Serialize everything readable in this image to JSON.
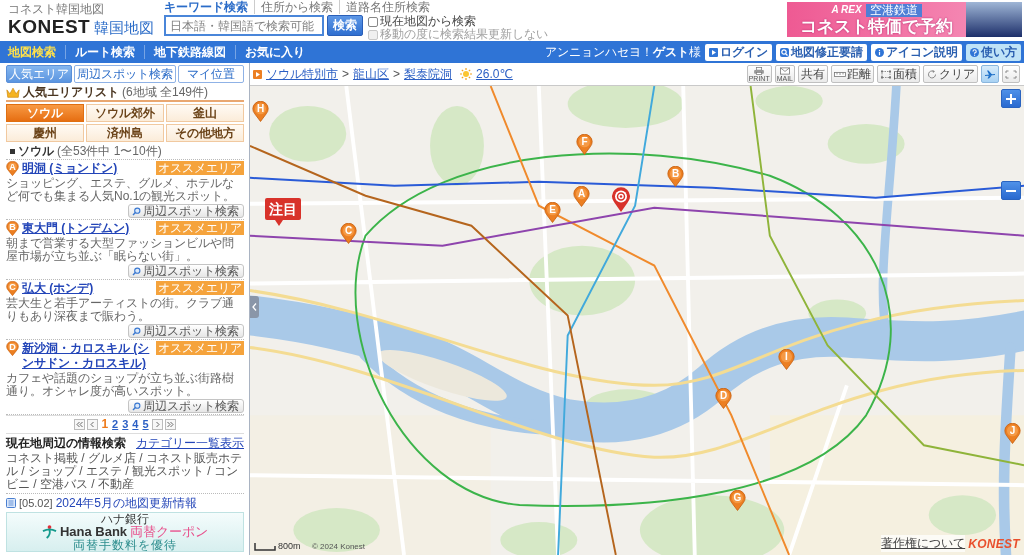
{
  "header": {
    "logo_caption": "コネスト韓国地図",
    "logo": "KONEST",
    "logo_suffix": "韓国地図",
    "search_tabs": [
      {
        "label": "キーワード検索",
        "selected": true
      },
      {
        "label": "住所から検索",
        "selected": false
      },
      {
        "label": "道路名住所検索",
        "selected": false
      }
    ],
    "search": {
      "placeholder": "日本語・韓国語で検索可能",
      "button": "検索"
    },
    "options": [
      {
        "label": "現在地図から検索",
        "checked": false,
        "disabled": false
      },
      {
        "label": "移動の度に検索結果更新しない",
        "checked": false,
        "disabled": true
      }
    ],
    "banner": {
      "brand": "A REX",
      "tag": "空港鉄道",
      "headline": "コネスト特価で予約"
    }
  },
  "nav": {
    "items": [
      {
        "label": "地図検索",
        "selected": true
      },
      {
        "label": "ルート検索",
        "selected": false
      },
      {
        "label": "地下鉄路線図",
        "selected": false
      },
      {
        "label": "お気に入り",
        "selected": false
      }
    ],
    "greeting": "アンニョンハセヨ！**ゲスト**様",
    "buttons": [
      {
        "kind": "login",
        "label": "ログイン"
      },
      {
        "kind": "report",
        "label": "地図修正要請"
      },
      {
        "kind": "info",
        "label": "アイコン説明"
      },
      {
        "kind": "help",
        "label": "使い方"
      }
    ]
  },
  "sidebar": {
    "tabs": [
      {
        "label": "人気エリア",
        "selected": true
      },
      {
        "label": "周辺スポット検索",
        "selected": false
      },
      {
        "label": "マイ位置",
        "selected": false
      }
    ],
    "list_title": "**人気エリア**リスト",
    "list_count": "(6地域 全149件)",
    "regions": [
      {
        "label": "ソウル",
        "selected": true
      },
      {
        "label": "ソウル郊外",
        "selected": false
      },
      {
        "label": "釜山",
        "selected": false
      },
      {
        "label": "慶州",
        "selected": false
      },
      {
        "label": "済州島",
        "selected": false
      },
      {
        "label": "その他地方",
        "selected": false
      }
    ],
    "section": {
      "title": "ソウル",
      "count": "(全53件中 1〜10件)"
    },
    "areas": [
      {
        "marker": "A",
        "name": "明洞 (ミョンドン)",
        "badge": "オススメエリア",
        "description": "ショッピング、エステ、グルメ、ホテルなど何でも集まる人気No.1の観光スポット。",
        "button": "周辺スポット検索"
      },
      {
        "marker": "B",
        "name": "東大門 (トンデムン)",
        "badge": "オススメエリア",
        "description": "朝まで営業する大型ファッションビルや問屋市場が立ち並ぶ「眠らない街」。",
        "button": "周辺スポット検索"
      },
      {
        "marker": "C",
        "name": "弘大 (ホンデ)",
        "badge": "オススメエリア",
        "description": "芸大生と若手アーティストの街。クラブ通りもあり深夜まで賑わう。",
        "button": "周辺スポット検索"
      },
      {
        "marker": "D",
        "name": "新沙洞・カロスキル (シンサドン・カロスキル)",
        "badge": "オススメエリア",
        "description": "カフェや話題のショップが立ち並ぶ街路樹通り。オシャレ度が高いスポット。",
        "button": "周辺スポット検索"
      }
    ],
    "pages": [
      {
        "label": "1",
        "selected": true
      },
      {
        "label": "2",
        "selected": false
      },
      {
        "label": "3",
        "selected": false
      },
      {
        "label": "4",
        "selected": false
      },
      {
        "label": "5",
        "selected": false
      }
    ],
    "info": {
      "title": "現在地周辺の情報検索",
      "link": "カテゴリー一覧表示",
      "categories": "コネスト掲載 / グルメ店 / コネスト販売ホテル / ショップ / エステ / 観光スポット / コンビニ / 空港バス / 不動産"
    },
    "news": {
      "date": "[05.02]",
      "text": "2024年5月の地図更新情報"
    },
    "ad": {
      "caption": "ハナ銀行",
      "bank": "Hana Bank",
      "offer": "両替クーポン",
      "note": "両替手数料を優待"
    }
  },
  "map": {
    "breadcrumb": [
      {
        "kind": "link",
        "label": "ソウル特別市"
      },
      {
        "kind": "separator",
        "label": ">"
      },
      {
        "kind": "link",
        "label": "龍山区"
      },
      {
        "kind": "separator",
        "label": ">"
      },
      {
        "kind": "link",
        "label": "梨泰院洞"
      }
    ],
    "temperature": "26.0℃",
    "tools": [
      {
        "kind": "print",
        "label": "PRINT"
      },
      {
        "kind": "mail",
        "label": "MAIL"
      },
      {
        "kind": "share",
        "label": "共有"
      },
      {
        "kind": "distance",
        "label": "距離"
      },
      {
        "kind": "area",
        "label": "面積"
      },
      {
        "kind": "clear",
        "label": "クリア"
      },
      {
        "kind": "plane"
      },
      {
        "kind": "fullscreen"
      }
    ],
    "markers": [
      {
        "label": "H"
      },
      {
        "label": "F"
      },
      {
        "label": "B"
      },
      {
        "label": "A"
      },
      {
        "label": "E"
      },
      {
        "label": "C"
      },
      {
        "label": "I"
      },
      {
        "label": "D"
      },
      {
        "label": "G"
      },
      {
        "label": "J"
      }
    ],
    "featured_badge": "注目",
    "scale": "800m",
    "copyright": "© 2024 Konest",
    "credits_link": "著作権について",
    "credits_logo": "KONEST"
  }
}
